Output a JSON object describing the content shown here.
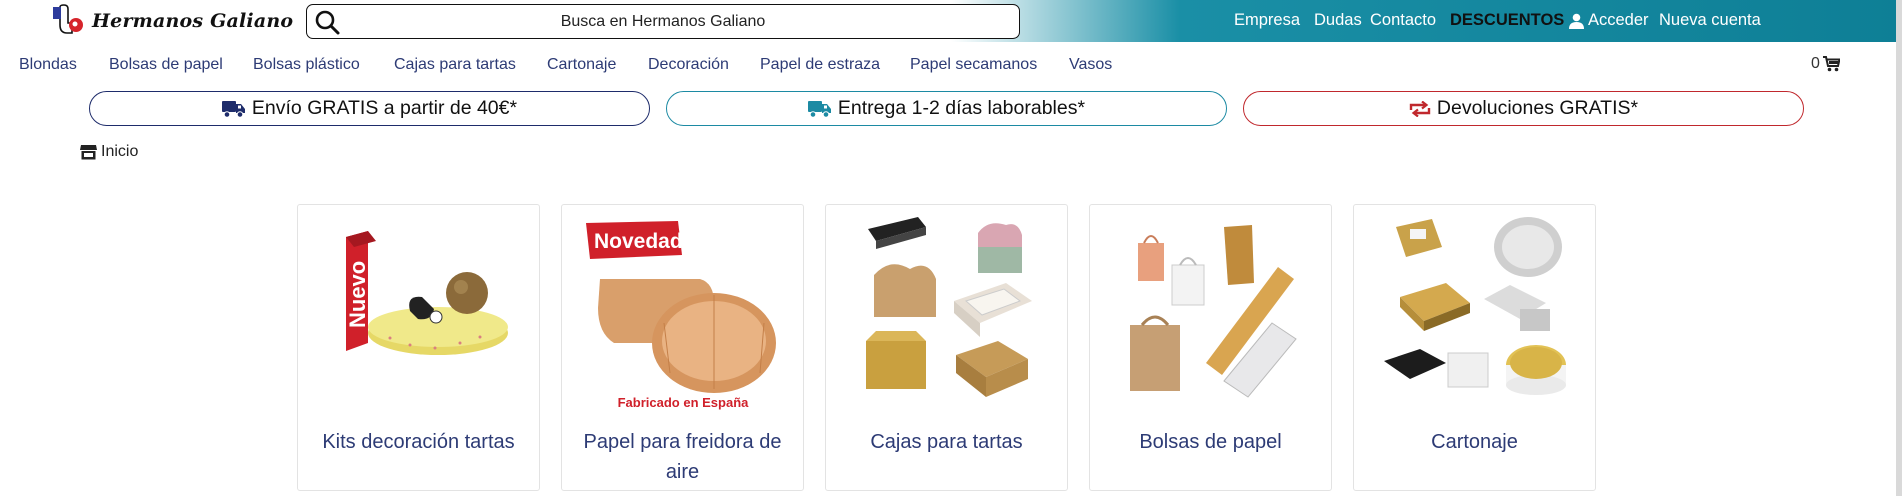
{
  "brand": {
    "name": "Hermanos Galiano"
  },
  "search": {
    "placeholder": "Busca en Hermanos Galiano"
  },
  "topnav": {
    "empresa": "Empresa",
    "dudas": "Dudas",
    "contacto": "Contacto",
    "descuentos": "DESCUENTOS",
    "acceder": "Acceder",
    "nueva_cuenta": "Nueva cuenta"
  },
  "categories": [
    "Blondas",
    "Bolsas de papel",
    "Bolsas plástico",
    "Cajas para tartas",
    "Cartonaje",
    "Decoración",
    "Papel de estraza",
    "Papel secamanos",
    "Vasos"
  ],
  "cart": {
    "count": "0"
  },
  "banners": {
    "shipping": "Envío GRATIS a partir de 40€*",
    "delivery": "Entrega 1-2 días laborables*",
    "returns": "Devoluciones GRATIS*"
  },
  "breadcrumb": {
    "home": "Inicio"
  },
  "products": [
    {
      "title": "Kits decoración tartas",
      "badge": "Nuevo"
    },
    {
      "title": "Papel para freidora de aire",
      "badge": "Novedad",
      "caption": "Fabricado en España"
    },
    {
      "title": "Cajas para tartas"
    },
    {
      "title": "Bolsas de papel"
    },
    {
      "title": "Cartonaje"
    }
  ],
  "colors": {
    "navy": "#1e2c6b",
    "teal": "#1c8aa3",
    "red": "#c0282d",
    "link": "#2d3b75"
  }
}
